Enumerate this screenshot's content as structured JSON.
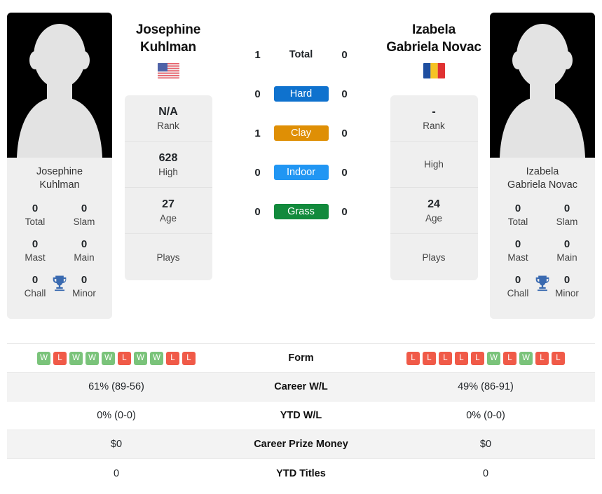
{
  "players": {
    "left": {
      "name_line1": "Josephine",
      "name_line2": "Kuhlman",
      "full_name": "Josephine Kuhlman",
      "photo_caption_line1": "Josephine",
      "photo_caption_line2": "Kuhlman",
      "country": "United States",
      "flag_icon": "us-flag-icon",
      "rank": "N/A",
      "rank_label": "Rank",
      "high": "628",
      "high_label": "High",
      "age": "27",
      "age_label": "Age",
      "plays": "",
      "plays_label": "Plays",
      "titles": {
        "total": "0",
        "total_label": "Total",
        "slam": "0",
        "slam_label": "Slam",
        "mast": "0",
        "mast_label": "Mast",
        "main": "0",
        "main_label": "Main",
        "chall": "0",
        "chall_label": "Chall",
        "minor": "0",
        "minor_label": "Minor"
      },
      "form": [
        "W",
        "L",
        "W",
        "W",
        "W",
        "L",
        "W",
        "W",
        "L",
        "L"
      ],
      "career_wl": "61% (89-56)",
      "ytd_wl": "0% (0-0)",
      "career_prize_money": "$0",
      "ytd_titles": "0"
    },
    "right": {
      "name_line1": "Izabela",
      "name_line2": "Gabriela Novac",
      "full_name": "Izabela Gabriela Novac",
      "photo_caption_line1": "Izabela",
      "photo_caption_line2": "Gabriela Novac",
      "country": "Romania",
      "flag_icon": "ro-flag-icon",
      "rank": "-",
      "rank_label": "Rank",
      "high": "",
      "high_label": "High",
      "age": "24",
      "age_label": "Age",
      "plays": "",
      "plays_label": "Plays",
      "titles": {
        "total": "0",
        "total_label": "Total",
        "slam": "0",
        "slam_label": "Slam",
        "mast": "0",
        "mast_label": "Mast",
        "main": "0",
        "main_label": "Main",
        "chall": "0",
        "chall_label": "Chall",
        "minor": "0",
        "minor_label": "Minor"
      },
      "form": [
        "L",
        "L",
        "L",
        "L",
        "L",
        "W",
        "L",
        "W",
        "L",
        "L"
      ],
      "career_wl": "49% (86-91)",
      "ytd_wl": "0% (0-0)",
      "career_prize_money": "$0",
      "ytd_titles": "0"
    }
  },
  "surfaces": [
    {
      "label": "Total",
      "left": "1",
      "right": "0",
      "color": "",
      "plain": true
    },
    {
      "label": "Hard",
      "left": "0",
      "right": "0",
      "color": "#0f72ce",
      "plain": false
    },
    {
      "label": "Clay",
      "left": "1",
      "right": "0",
      "color": "#df8f05",
      "plain": false
    },
    {
      "label": "Indoor",
      "left": "0",
      "right": "0",
      "color": "#2196f3",
      "plain": false
    },
    {
      "label": "Grass",
      "left": "0",
      "right": "0",
      "color": "#128a3c",
      "plain": false
    }
  ],
  "stats_rows": [
    {
      "label": "Form",
      "key": "form",
      "type": "form"
    },
    {
      "label": "Career W/L",
      "key": "career_wl",
      "type": "text"
    },
    {
      "label": "YTD W/L",
      "key": "ytd_wl",
      "type": "text"
    },
    {
      "label": "Career Prize Money",
      "key": "career_prize_money",
      "type": "text"
    },
    {
      "label": "YTD Titles",
      "key": "ytd_titles",
      "type": "text"
    }
  ],
  "colors": {
    "win": "#7ac37a",
    "loss": "#f05a48",
    "card_bg": "#efefef",
    "row_alt_bg": "#f3f3f3",
    "trophy": "#3a6ab0"
  }
}
